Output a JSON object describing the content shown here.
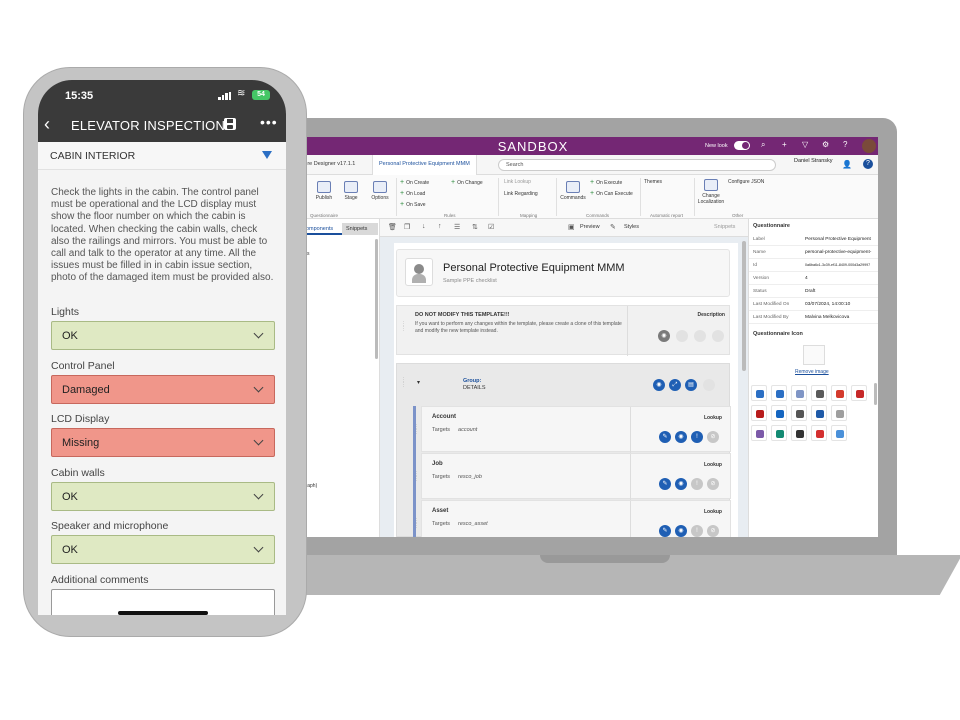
{
  "laptop": {
    "app_title": "SANDBOX",
    "new_look_label": "New look",
    "tabs": [
      "naire Designer v17.1.1",
      "Personal Protective Equipment MMM"
    ],
    "search_placeholder": "Search",
    "user_name": "Daniel Stransky",
    "ribbon": {
      "questionnaire": {
        "group": "Questionnaire",
        "buttons": [
          "Publish",
          "Stage",
          "Options"
        ]
      },
      "rules": {
        "group": "Rules",
        "items": [
          "On Create",
          "On Load",
          "On Save",
          "On Change"
        ]
      },
      "mapping": {
        "group": "Mapping",
        "items": [
          "Link Lookup",
          "Link Regarding"
        ]
      },
      "commands": {
        "group": "Commands",
        "button": "Commands",
        "items": [
          "On Execute",
          "On Can Execute"
        ]
      },
      "automatic_report": {
        "group": "Automatic report",
        "items": [
          "Themes"
        ]
      },
      "other": {
        "group": "Other",
        "button": "Change Localization",
        "items": [
          "Configure JSON"
        ]
      }
    },
    "left_panel": {
      "tabs": [
        "Components",
        "Snippets"
      ],
      "items": [
        "ents",
        "er",
        "agraph)"
      ]
    },
    "canvas_toolbar": {
      "preview": "Preview",
      "styles": "Styles",
      "snippets": "Snippets"
    },
    "form": {
      "title": "Personal Protective Equipment MMM",
      "subtitle": "Sample PPE checklist",
      "notice_title": "DO NOT MODIFY THIS TEMPLATE!!!",
      "notice_text": "If you want to perform any changes within the template, please create a clone of this template and modify the new template instead.",
      "notice_right": "Description",
      "group_label": "Group:",
      "group_name": "DETAILS",
      "fields": [
        {
          "label": "Account",
          "targets_label": "Targets",
          "target": "account",
          "type": "Lookup"
        },
        {
          "label": "Job",
          "targets_label": "Targets",
          "target": "resco_job",
          "type": "Lookup"
        },
        {
          "label": "Asset",
          "targets_label": "Targets",
          "target": "resco_asset",
          "type": "Lookup"
        }
      ]
    },
    "properties": {
      "title": "Questionnaire",
      "rows": [
        {
          "key": "Label",
          "value": "Personal Protective Equipment"
        },
        {
          "key": "Name",
          "value": "personal-protective-equipment-"
        },
        {
          "key": "Id",
          "value": "0a6ba6c1-3c39-ef11-8409-000d3a29997"
        },
        {
          "key": "Version",
          "value": "4"
        },
        {
          "key": "Status",
          "value": "Draft"
        },
        {
          "key": "Last Modified On",
          "value": "03/07/2024, 14:00:10"
        },
        {
          "key": "Last Modified By",
          "value": "Malvina Melkovicova"
        }
      ],
      "icon_title": "Questionnaire Icon",
      "remove_image": "Remove image"
    },
    "colors": {
      "brand": "#742774",
      "accent": "#1f5fb4"
    }
  },
  "phone": {
    "time": "15:35",
    "battery": "54",
    "title": "ELEVATOR INSPECTION",
    "section": "CABIN INTERIOR",
    "instructions": "Check the lights in the cabin. The control panel must be operational and the LCD display must show the floor number on which the cabin is located. When checking the cabin walls, check also the railings and mirrors. You must be able to call and talk to the operator at any time. All the issues must be filled in in cabin issue section, photo of the damaged item must be provided also.",
    "fields": [
      {
        "label": "Lights",
        "value": "OK",
        "status": "ok"
      },
      {
        "label": "Control Panel",
        "value": "Damaged",
        "status": "bad"
      },
      {
        "label": "LCD Display",
        "value": "Missing",
        "status": "bad"
      },
      {
        "label": "Cabin walls",
        "value": "OK",
        "status": "ok"
      },
      {
        "label": "Speaker and microphone",
        "value": "OK",
        "status": "ok"
      }
    ],
    "comments_label": "Additional comments",
    "colors": {
      "ok": "#dfe9c3",
      "bad": "#f0968a",
      "nav": "#3a3a3a"
    }
  }
}
